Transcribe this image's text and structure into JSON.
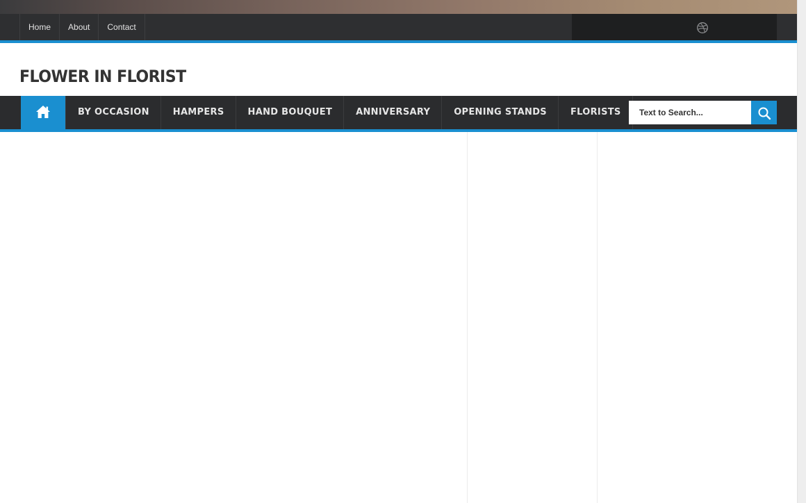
{
  "top_nav": {
    "links": [
      {
        "label": "Home"
      },
      {
        "label": "About"
      },
      {
        "label": "Contact"
      }
    ]
  },
  "social": {
    "icon": "dribbble-icon"
  },
  "site": {
    "title": "FLOWER IN FLORIST"
  },
  "main_nav": {
    "home_icon": "home-icon",
    "items": [
      {
        "label": "BY OCCASION"
      },
      {
        "label": "HAMPERS"
      },
      {
        "label": "HAND BOUQUET"
      },
      {
        "label": "ANNIVERSARY"
      },
      {
        "label": "OPENING STANDS"
      },
      {
        "label": "FLORISTS"
      }
    ]
  },
  "search": {
    "placeholder": "Text to Search...",
    "value": "",
    "icon": "search-icon"
  },
  "colors": {
    "accent": "#1a8fd0",
    "topbar_bg": "#2e2f31",
    "nav_bg": "#2b2c2e",
    "logo_text": "#333333"
  }
}
